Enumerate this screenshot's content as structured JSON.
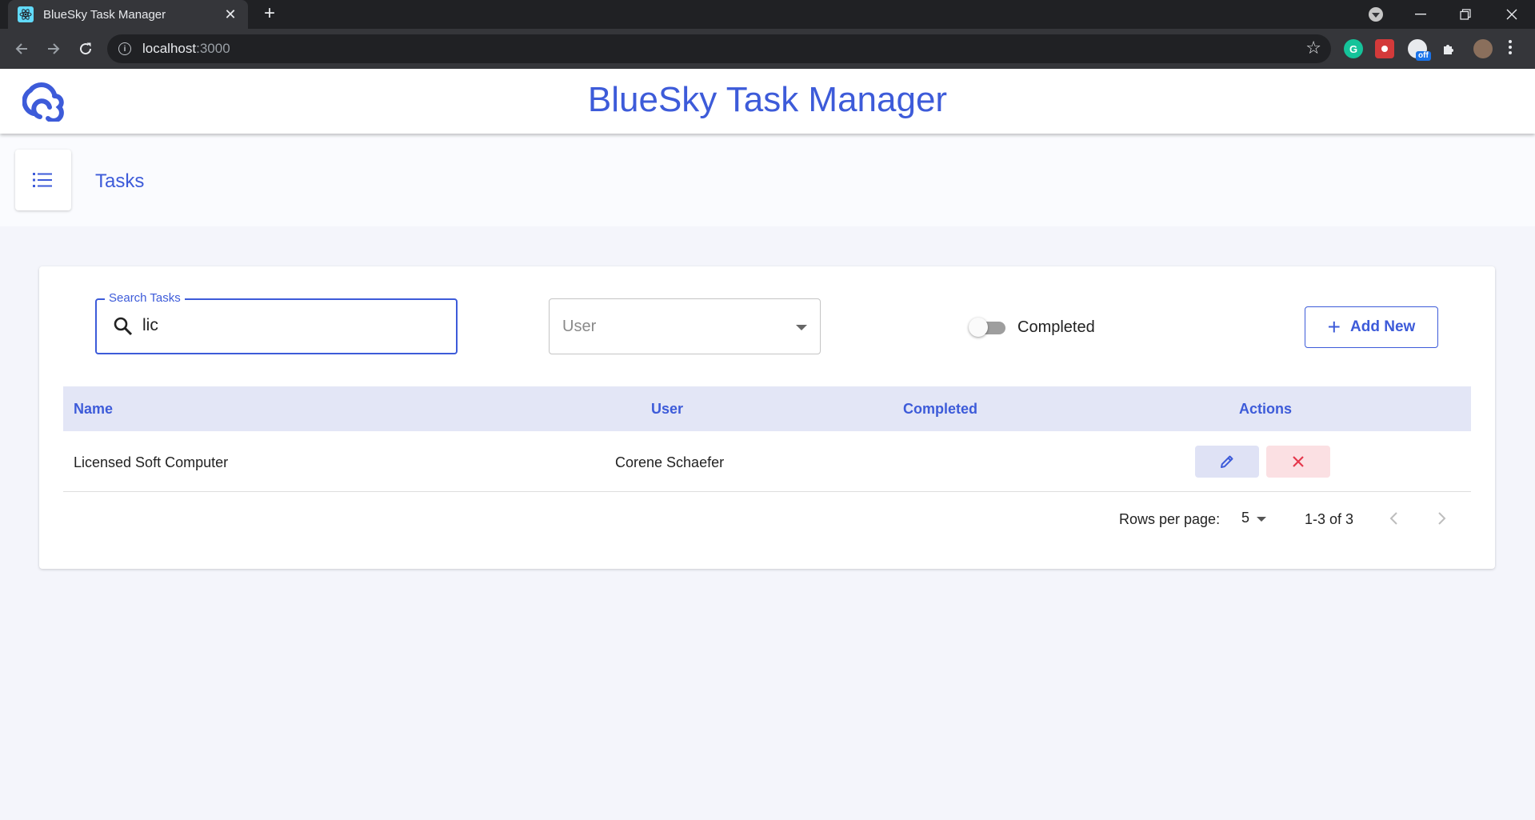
{
  "browser": {
    "tab_title": "BlueSky Task Manager",
    "tab_close": "✕",
    "new_tab": "+",
    "url_host": "localhost",
    "url_port": ":3000",
    "extension_badge": "off",
    "extension_grammarly": "G"
  },
  "header": {
    "title": "BlueSky Task Manager"
  },
  "page": {
    "title": "Tasks"
  },
  "filters": {
    "search_label": "Search Tasks",
    "search_value": "lic",
    "user_placeholder": "User",
    "completed_label": "Completed",
    "completed_on": false,
    "add_new_label": "Add New",
    "add_new_icon": "+"
  },
  "table": {
    "columns": [
      "Name",
      "User",
      "Completed",
      "Actions"
    ],
    "rows": [
      {
        "name": "Licensed Soft Computer",
        "user": "Corene Schaefer",
        "completed": ""
      }
    ]
  },
  "pagination": {
    "rows_per_page_label": "Rows per page:",
    "rows_per_page": "5",
    "range": "1-3 of 3"
  },
  "colors": {
    "accent": "#3d5bd9",
    "header_bg": "#e3e6f6",
    "edit_bg": "#dfe2f5",
    "delete_bg": "#fbe0e3",
    "delete_icon": "#e5384c"
  },
  "icons": {
    "logo": "cloud-logo-icon",
    "menu": "list-icon",
    "search": "search-icon",
    "edit": "pencil-icon",
    "delete": "close-icon",
    "prev": "chevron-left-icon",
    "next": "chevron-right-icon"
  }
}
